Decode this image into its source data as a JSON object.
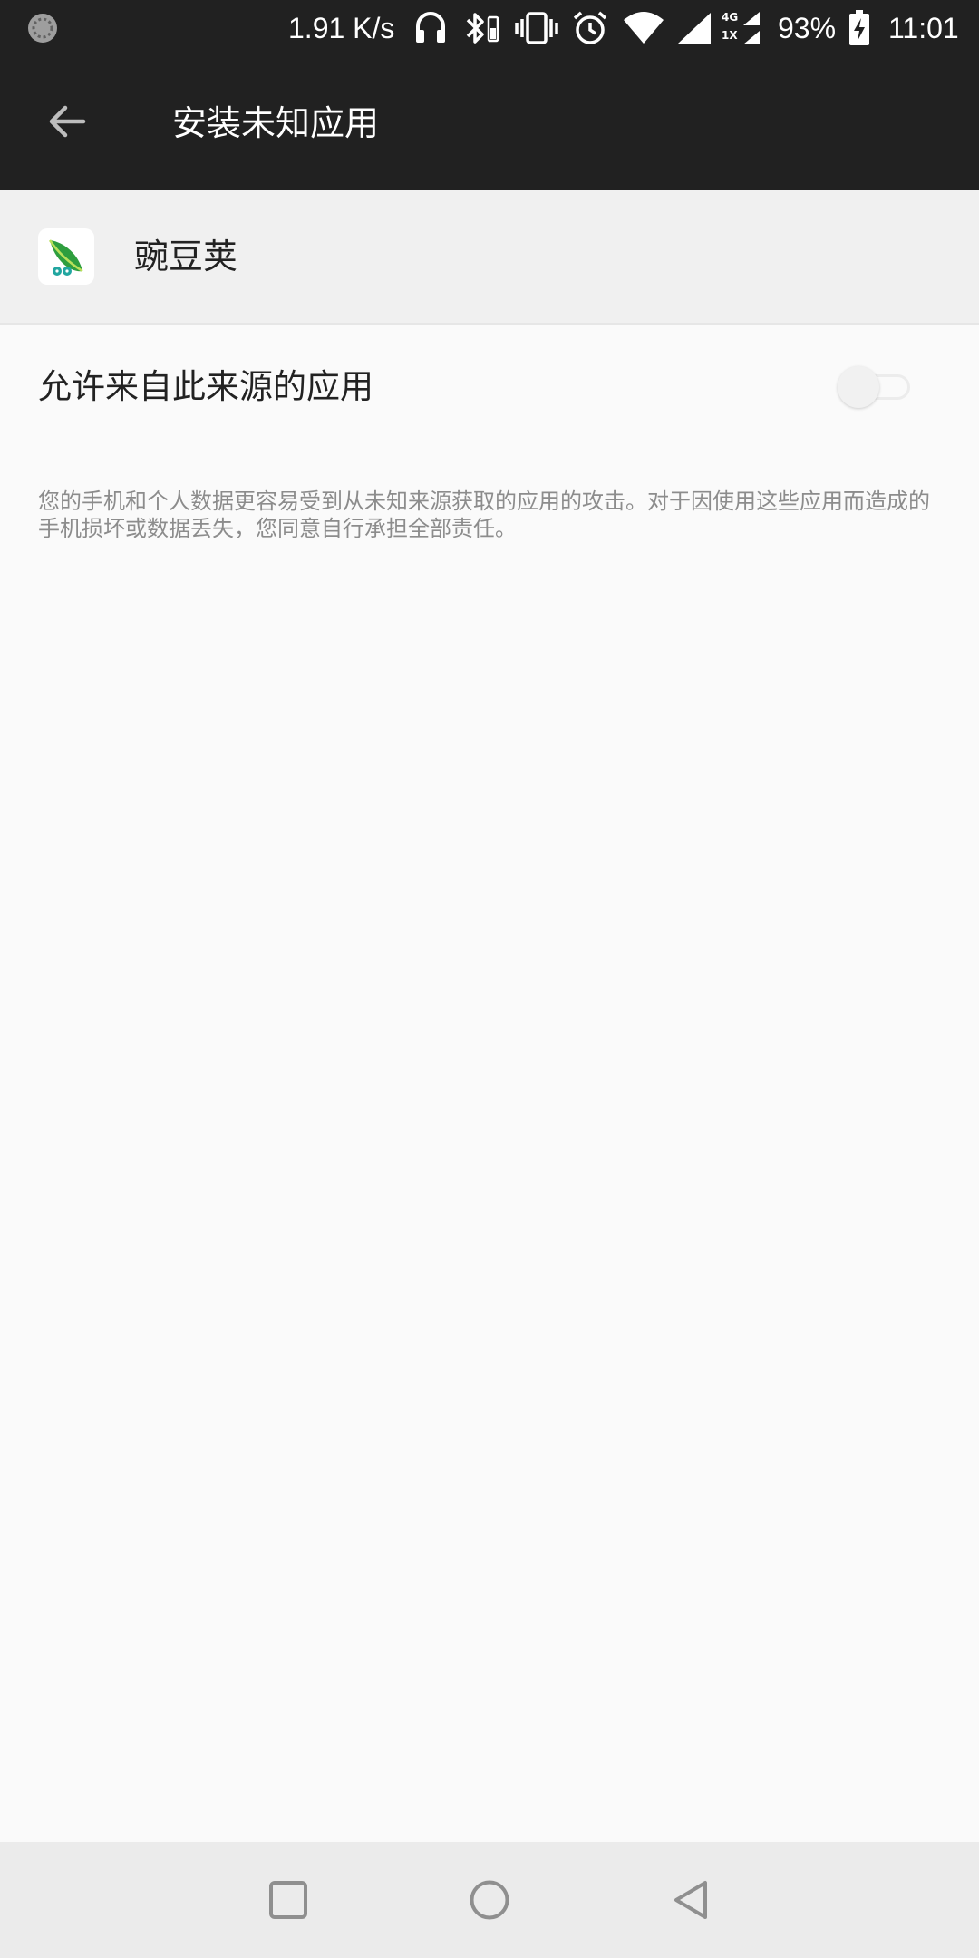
{
  "status_bar": {
    "network_speed": "1.91 K/s",
    "battery_percent": "93%",
    "time": "11:01",
    "network_type_top": "4G",
    "network_type_bottom": "1X",
    "icons": [
      "sync-icon",
      "headphones-icon",
      "bluetooth-icon",
      "vibrate-icon",
      "alarm-icon",
      "wifi-icon",
      "signal-icon",
      "dual-signal-icon",
      "battery-charging-icon"
    ]
  },
  "app_bar": {
    "title": "安装未知应用",
    "back_icon": "arrow-left-icon"
  },
  "app_header": {
    "app_name": "豌豆荚",
    "app_icon": "wandoujia-icon"
  },
  "allow_setting": {
    "label": "允许来自此来源的应用",
    "enabled": false
  },
  "warning": {
    "text": "您的手机和个人数据更容易受到从未知来源获取的应用的攻击。对于因使用这些应用而造成的手机损坏或数据丢失，您同意自行承担全部责任。"
  },
  "nav_bar": {
    "buttons": [
      "recents-icon",
      "home-icon",
      "back-icon"
    ]
  },
  "colors": {
    "bar_dark": "#212121",
    "page_bg": "#fafafa",
    "header_bg": "#f0f0f0",
    "nav_bg": "#ebebeb",
    "secondary_text": "#8c8c8c"
  }
}
